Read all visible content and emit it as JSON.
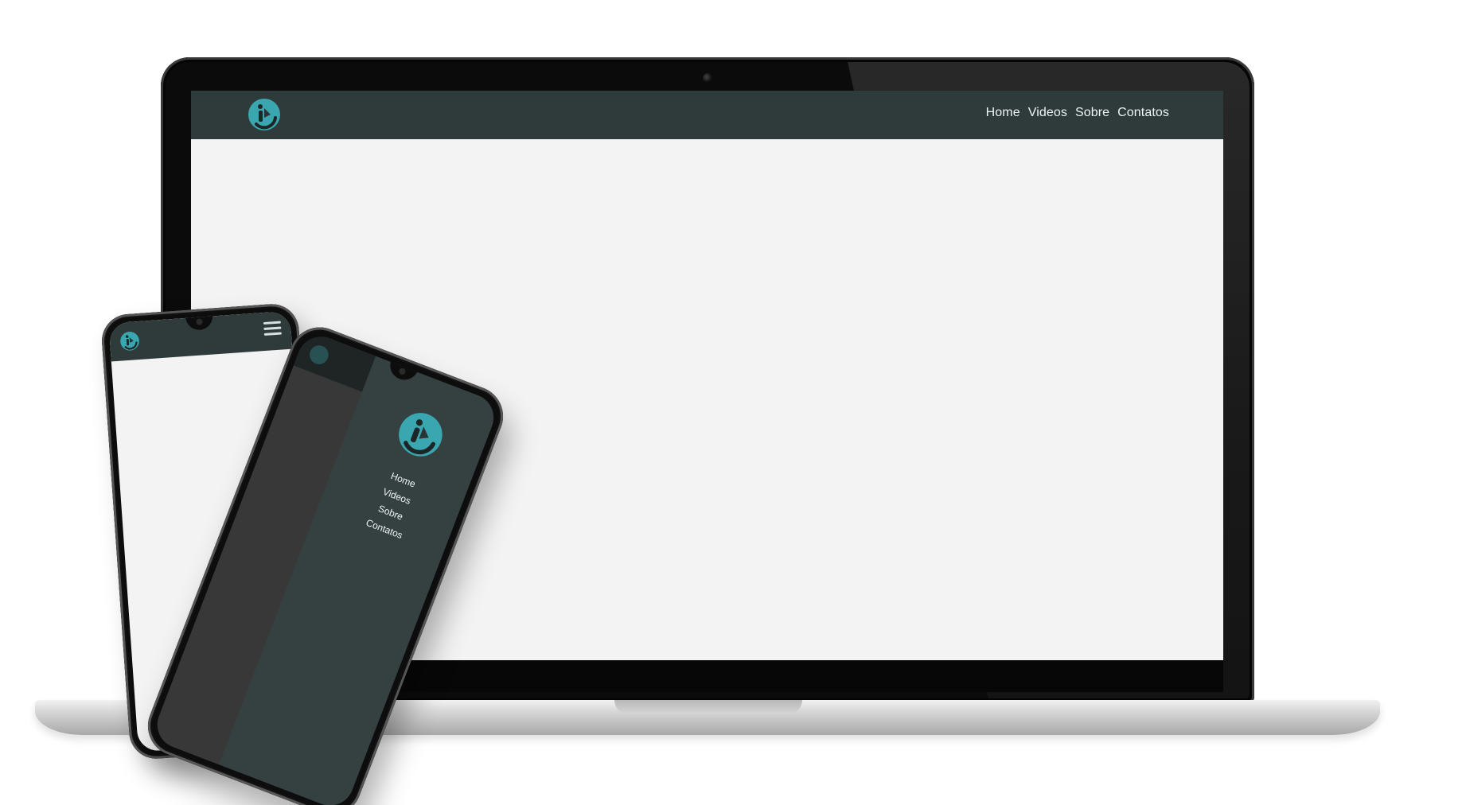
{
  "colors": {
    "header_bg": "#2f3b3b",
    "page_bg": "#f3f3f3",
    "accent_teal": "#3aa7b0",
    "menu_panel_bg": "#354141",
    "nav_text": "#eef3f3"
  },
  "desktop": {
    "logo_icon": "brand-logo-icon",
    "nav": [
      "Home",
      "Videos",
      "Sobre",
      "Contatos"
    ]
  },
  "mobile_closed": {
    "logo_icon": "brand-logo-icon",
    "menu_icon": "hamburger-menu-icon"
  },
  "mobile_open": {
    "logo_icon": "brand-logo-icon",
    "nav": [
      "Home",
      "Videos",
      "Sobre",
      "Contatos"
    ]
  }
}
